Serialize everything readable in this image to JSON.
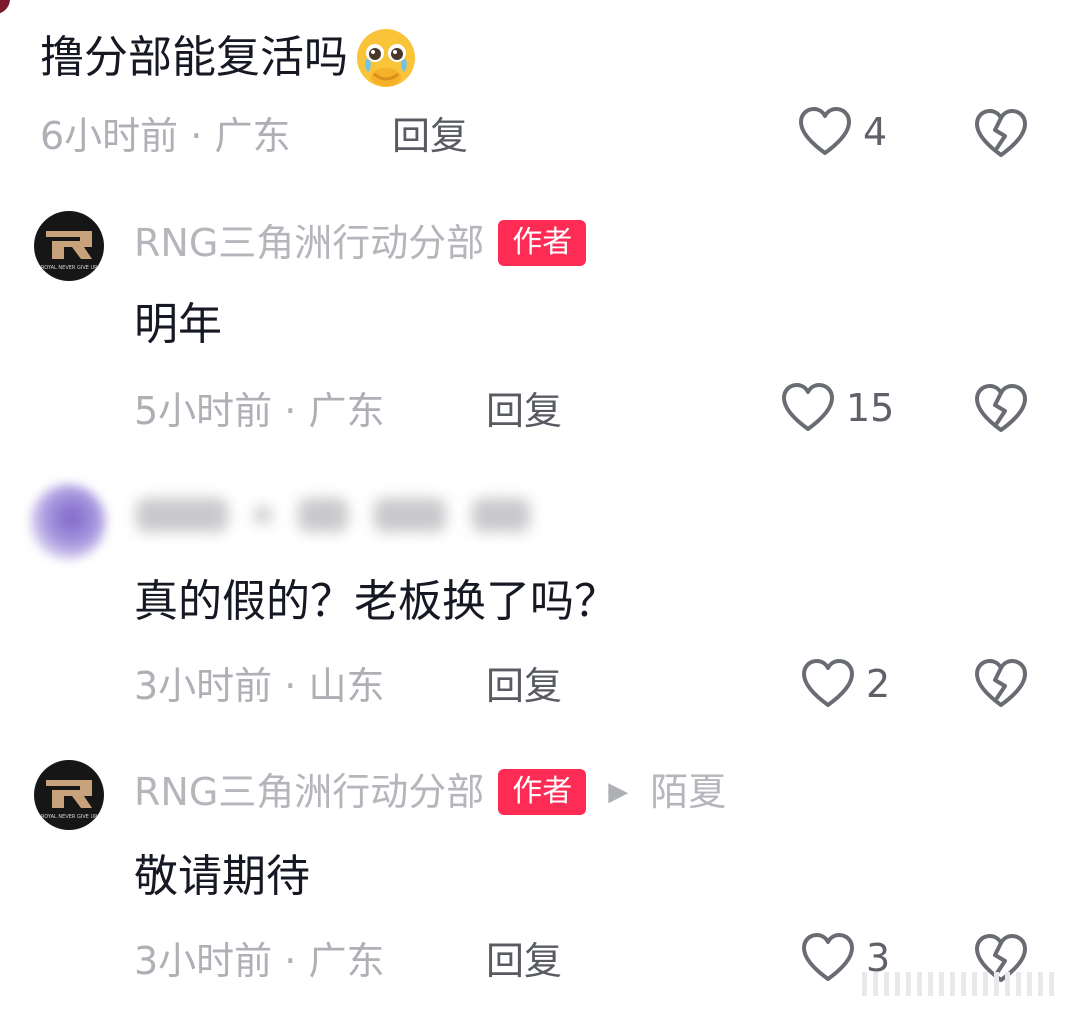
{
  "comments": [
    {
      "content": "撸分部能复活吗",
      "emoji_icon": "pleading-face-icon",
      "time": "6小时前",
      "location": "广东",
      "reply_label": "回复",
      "likes": "4"
    },
    {
      "username": "RNG三角洲行动分部",
      "author_tag": "作者",
      "avatar_logo": "RNG",
      "avatar_motto": "ROYAL NEVER GIVE UP",
      "content": "明年",
      "time": "5小时前",
      "location": "广东",
      "reply_label": "回复",
      "likes": "15"
    },
    {
      "username_blurred": true,
      "content": "真的假的？老板换了吗？",
      "time": "3小时前",
      "location": "山东",
      "reply_label": "回复",
      "likes": "2"
    },
    {
      "username": "RNG三角洲行动分部",
      "author_tag": "作者",
      "reply_to": "陌夏",
      "avatar_logo": "RNG",
      "avatar_motto": "ROYAL NEVER GIVE UP",
      "content": "敬请期待",
      "time": "3小时前",
      "location": "广东",
      "reply_label": "回复",
      "likes": "3"
    }
  ],
  "icons": {
    "like": "heart-outline-icon",
    "dislike": "broken-heart-icon",
    "reply_arrow": "play-arrow-icon"
  },
  "colors": {
    "author_tag": "#fe2c55",
    "text": "#161823",
    "meta": "#aeb0b5"
  }
}
